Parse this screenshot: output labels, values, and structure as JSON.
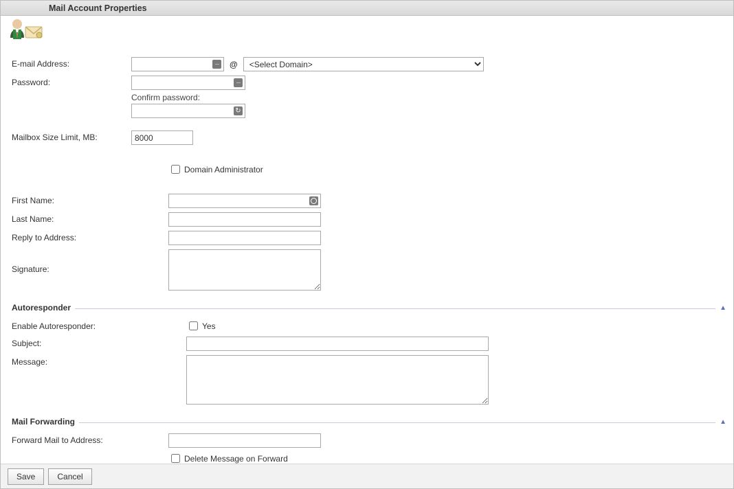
{
  "window": {
    "title": "Mail Account Properties"
  },
  "labels": {
    "email": "E-mail Address:",
    "password": "Password:",
    "confirm_password": "Confirm password:",
    "mailbox_limit": "Mailbox Size Limit, MB:",
    "domain_admin": "Domain Administrator",
    "first_name": "First Name:",
    "last_name": "Last Name:",
    "reply_to": "Reply to Address:",
    "signature": "Signature:",
    "autoresponder_section": "Autoresponder",
    "enable_autoresponder": "Enable Autoresponder:",
    "autoresponder_yes": "Yes",
    "subject": "Subject:",
    "message": "Message:",
    "mail_forwarding_section": "Mail Forwarding",
    "forward_to": "Forward Mail to Address:",
    "delete_on_forward": "Delete Message on Forward"
  },
  "values": {
    "email": "",
    "at": "@",
    "domain_placeholder": "<Select Domain>",
    "password": "",
    "confirm_password": "",
    "mailbox_limit": "8000",
    "domain_admin_checked": false,
    "first_name": "",
    "last_name": "",
    "reply_to": "",
    "signature": "",
    "enable_autoresponder_checked": false,
    "subject": "",
    "message": "",
    "forward_to": "",
    "delete_on_forward_checked": false
  },
  "buttons": {
    "save": "Save",
    "cancel": "Cancel"
  }
}
